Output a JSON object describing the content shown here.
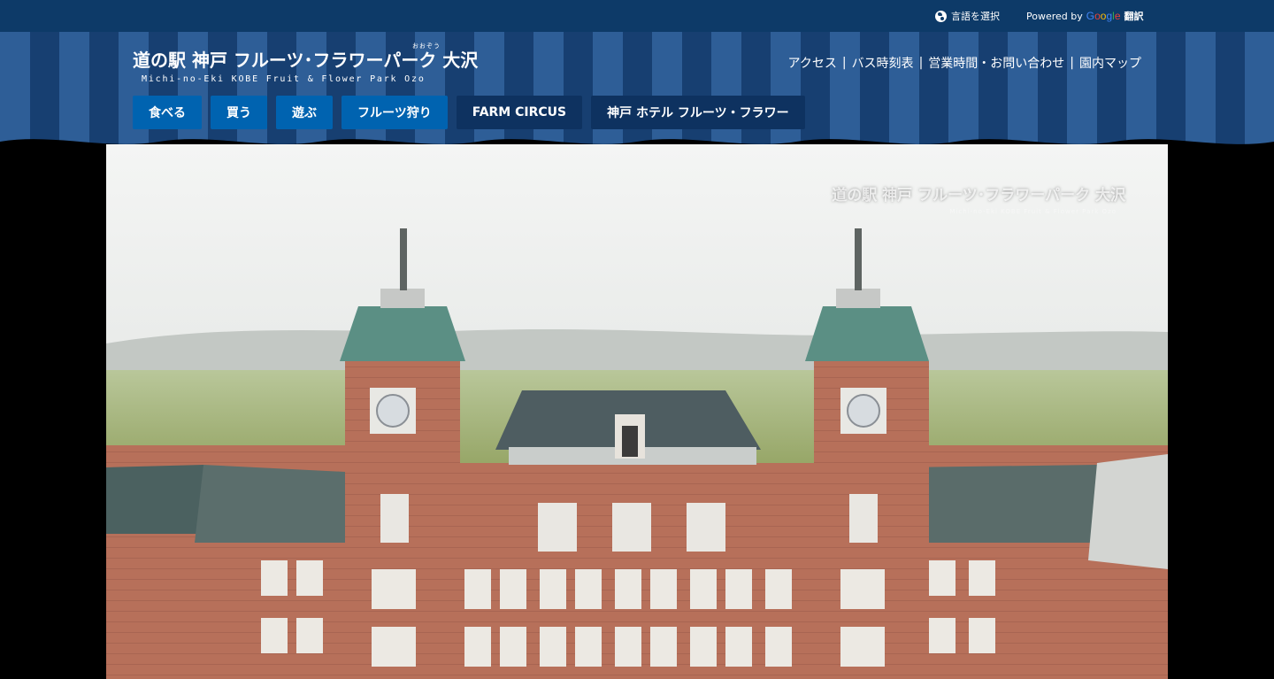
{
  "utility": {
    "language_label": "言語を選択",
    "powered_by": "Powered by",
    "google": "Google",
    "translate": "翻訳"
  },
  "logo": {
    "main": "道の駅 神戸 フルーツ･フラワーパーク 大沢",
    "ruby": "おおぞう",
    "sub": "Michi-no-Eki KOBE Fruit & Flower Park Ozo"
  },
  "top_links": [
    "アクセス",
    "バス時刻表",
    "営業時間・お問い合わせ",
    "園内マップ"
  ],
  "separator": "|",
  "main_nav": [
    {
      "label": "食べる",
      "style": "light"
    },
    {
      "label": "買う",
      "style": "light"
    },
    {
      "label": "遊ぶ",
      "style": "light"
    },
    {
      "label": "フルーツ狩り",
      "style": "light"
    },
    {
      "label": "FARM CIRCUS",
      "style": "dark"
    },
    {
      "label": "神戸 ホテル フルーツ・フラワー",
      "style": "dark"
    }
  ],
  "hero": {
    "watermark": "道の駅 神戸 フルーツ･フラワーパーク 大沢",
    "watermark_sub": "Michi-no-Eki KOBE Fruit & Flower Park Ozo"
  },
  "colors": {
    "utility_bar": "#0d3a68",
    "stripe_light": "#2e5e97",
    "stripe_dark": "#173f71",
    "nav_light": "#0063b0",
    "nav_dark": "#0e3260"
  }
}
